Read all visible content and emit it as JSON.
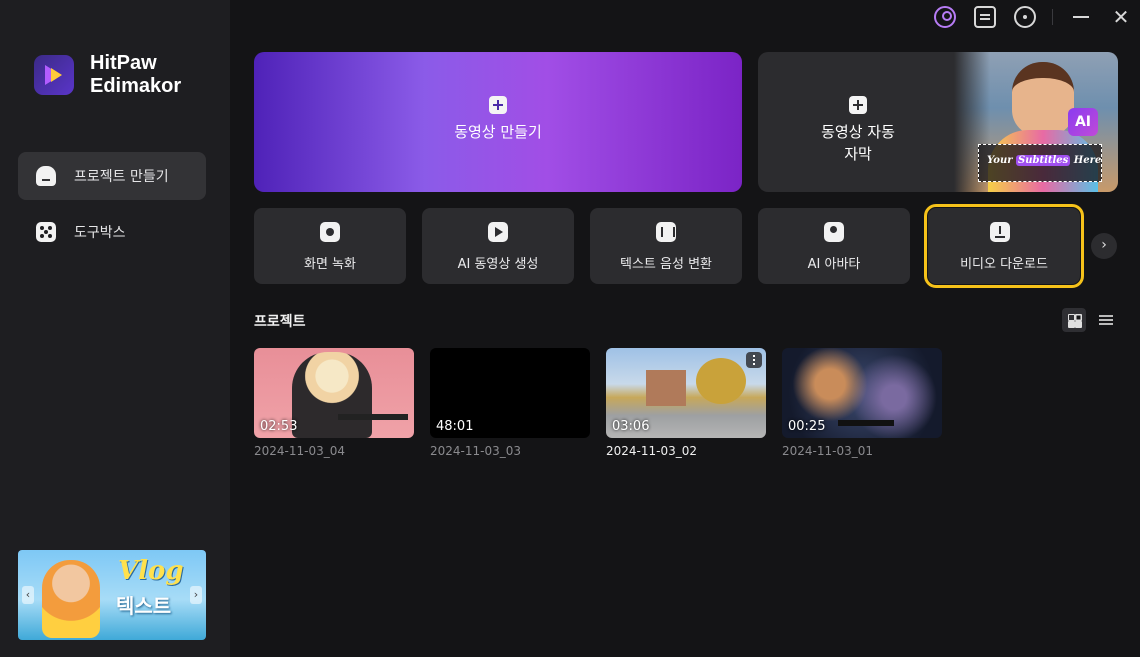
{
  "app": {
    "name_line1": "HitPaw",
    "name_line2": "Edimakor"
  },
  "sidebar": {
    "items": [
      {
        "label": "프로젝트 만들기",
        "icon": "home-icon",
        "active": true
      },
      {
        "label": "도구박스",
        "icon": "toolbox-icon",
        "active": false
      }
    ],
    "promo": {
      "title": "Vlog",
      "subtitle": "텍스트"
    }
  },
  "hero": {
    "create_label": "동영상 만들기",
    "subtitle_label_line1": "동영상 자동",
    "subtitle_label_line2": "자막",
    "subtitle_art": {
      "ai_badge": "AI",
      "caption_prefix": "Your",
      "caption_highlight": "Subtitles",
      "caption_suffix": "Here"
    }
  },
  "tools": [
    {
      "label": "화면 녹화",
      "icon": "webcam-icon"
    },
    {
      "label": "AI 동영상 생성",
      "icon": "ai-video-icon"
    },
    {
      "label": "텍스트 음성 변환",
      "icon": "text-to-speech-icon"
    },
    {
      "label": "AI 아바타",
      "icon": "avatar-icon"
    },
    {
      "label": "비디오 다운로드",
      "icon": "download-icon",
      "highlighted": true
    }
  ],
  "projects": {
    "title": "프로젝트",
    "items": [
      {
        "duration": "02:53",
        "name": "2024-11-03_04"
      },
      {
        "duration": "48:01",
        "name": "2024-11-03_03"
      },
      {
        "duration": "03:06",
        "name": "2024-11-03_02"
      },
      {
        "duration": "00:25",
        "name": "2024-11-03_01"
      }
    ]
  },
  "colors": {
    "accent": "#f6c21a",
    "brand": "#8b5be8",
    "profile": "#b77cf5"
  }
}
